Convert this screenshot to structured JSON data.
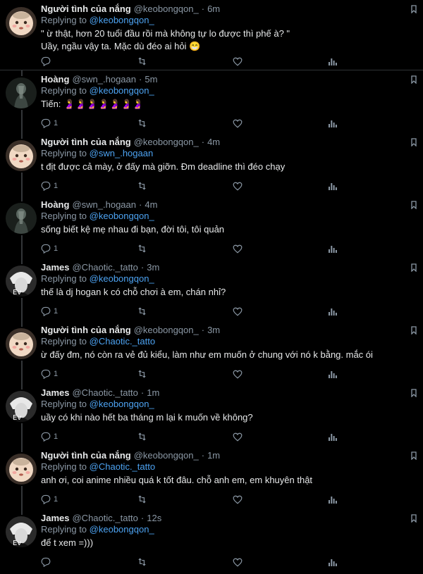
{
  "colors": {
    "background": "#000000",
    "name": "#e7e9ea",
    "meta": "#8b98a5",
    "mention": "#4da3f2",
    "divider": "#2f3336"
  },
  "replying_to_label": "Replying to",
  "tweets": [
    {
      "avatar": "baby-avatar",
      "name": "Người tình của nắng",
      "handle": "@keobongqon_",
      "time": "6m",
      "reply_to": "@keobongqon_",
      "lines": [
        "\" ừ thật, hơn 20 tuổi đầu rồi mà không tự lo được thì phế à? \"",
        "Uầy, ngầu vậy ta. Mặc dù đéo ai hỏi 😁"
      ],
      "reply_count": ""
    },
    {
      "avatar": "dark-avatar",
      "name": "Hoàng",
      "handle": "@swn_.hogaan",
      "time": "5m",
      "reply_to": "@keobongqon_",
      "lines": [
        "Tiến: 🤰🤰🤰🤰🤰🤰🤰"
      ],
      "reply_count": "1"
    },
    {
      "avatar": "baby-avatar",
      "name": "Người tình của nắng",
      "handle": "@keobongqon_",
      "time": "4m",
      "reply_to": "@swn_.hogaan",
      "lines": [
        "t địt được cả mày, ở đấy mà giỡn. Đm deadline thì đéo chạy"
      ],
      "reply_count": "1"
    },
    {
      "avatar": "dark-avatar",
      "name": "Hoàng",
      "handle": "@swn_.hogaan",
      "time": "4m",
      "reply_to": "@keobongqon_",
      "lines": [
        "sống biết kệ mẹ nhau đi bạn, đời tôi, tôi quản"
      ],
      "reply_count": "1"
    },
    {
      "avatar": "anime-avatar",
      "name": "James",
      "handle": "@Chaotic._tatto",
      "time": "3m",
      "reply_to": "@keobongqon_",
      "lines": [
        "thế là dj hogan k có chỗ chơi à em, chán nhỉ?"
      ],
      "reply_count": "1"
    },
    {
      "avatar": "baby-avatar",
      "name": "Người tình của nắng",
      "handle": "@keobongqon_",
      "time": "3m",
      "reply_to": "@Chaotic._tatto",
      "lines": [
        "ừ đấy đm, nó còn ra vẻ đủ kiểu, làm như em muốn ở chung với nó k bằng. mắc ói"
      ],
      "reply_count": "1"
    },
    {
      "avatar": "anime-avatar",
      "name": "James",
      "handle": "@Chaotic._tatto",
      "time": "1m",
      "reply_to": "@keobongqon_",
      "lines": [
        "uầy có khi nào hết ba tháng m lại k muốn về không?"
      ],
      "reply_count": "1"
    },
    {
      "avatar": "baby-avatar",
      "name": "Người tình của nắng",
      "handle": "@keobongqon_",
      "time": "1m",
      "reply_to": "@Chaotic._tatto",
      "lines": [
        "anh ơi, coi anime nhiều quá k tốt đâu. chỗ anh em, em khuyên thật"
      ],
      "reply_count": "1"
    },
    {
      "avatar": "anime-avatar",
      "name": "James",
      "handle": "@Chaotic._tatto",
      "time": "12s",
      "reply_to": "@keobongqon_",
      "lines": [
        "để t xem =)))"
      ],
      "reply_count": ""
    }
  ]
}
